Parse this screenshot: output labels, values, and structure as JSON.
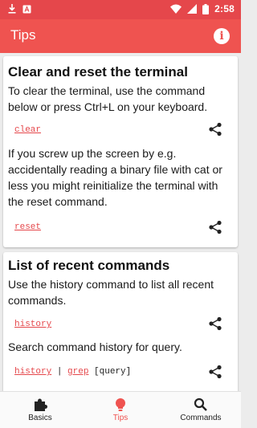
{
  "status_bar": {
    "time": "2:58",
    "left_icons": [
      "download-icon",
      "app-icon"
    ],
    "right_icons": [
      "wifi-icon",
      "signal-icon",
      "battery-icon"
    ]
  },
  "app_bar": {
    "title": "Tips",
    "info_icon": "i"
  },
  "tips": [
    {
      "title": "Clear and reset the terminal",
      "text1": "To clear the terminal, use the command below or press Ctrl+L on your keyboard.",
      "cmd1": "clear",
      "text2": "If you screw up the screen by e.g. accidentally reading a binary file with cat or less you might reinitialize the terminal with the reset command.",
      "cmd2": "reset"
    },
    {
      "title": "List of recent commands",
      "text1": "Use the history command to list all recent commands.",
      "cmd1": "history",
      "text2": "Search command history for query.",
      "cmd2_a": "history",
      "cmd2_pipe": " | ",
      "cmd2_b": "grep",
      "cmd2_arg": " [query]"
    }
  ],
  "bottom_nav": [
    {
      "label": "Basics",
      "icon": "puzzle-icon",
      "active": false
    },
    {
      "label": "Tips",
      "icon": "lightbulb-icon",
      "active": true
    },
    {
      "label": "Commands",
      "icon": "search-icon",
      "active": false
    }
  ],
  "colors": {
    "app_bar": "#ef5350",
    "status_bar": "#e5474b",
    "accent": "#ef5350"
  }
}
